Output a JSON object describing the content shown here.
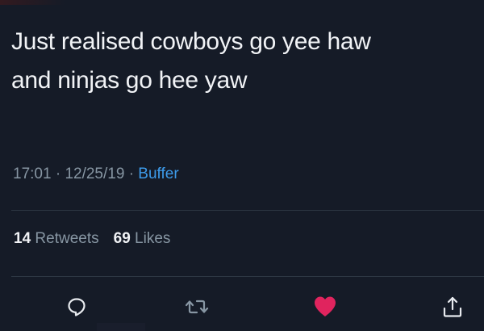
{
  "tweet": {
    "text_lines": [
      "Just realised cowboys go yee haw",
      "and ninjas go hee yaw"
    ],
    "time": "17:01",
    "date": "12/25/19",
    "separator": "·",
    "source": "Buffer",
    "retweets_count": "14",
    "retweets_label": "Retweets",
    "likes_count": "69",
    "likes_label": "Likes"
  },
  "actions": [
    {
      "name": "reply",
      "icon": "reply-icon"
    },
    {
      "name": "retweet",
      "icon": "retweet-icon"
    },
    {
      "name": "like",
      "icon": "heart-icon",
      "active": true
    },
    {
      "name": "share",
      "icon": "share-icon"
    }
  ],
  "colors": {
    "background": "#151b27",
    "text": "#f1f3f6",
    "muted": "#8796a3",
    "link": "#3d9bea",
    "like_active": "#e0245e",
    "divider": "#2d3743"
  }
}
